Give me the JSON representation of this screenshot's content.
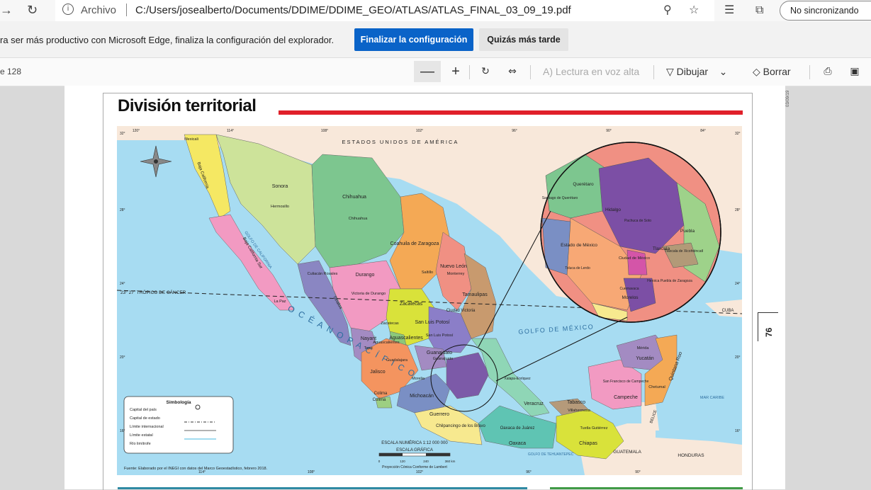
{
  "browser": {
    "scheme_label": "Archivo",
    "url": "C:/Users/josealberto/Documents/DDIME/DDIME_GEO/ATLAS/ATLAS_FINAL_03_09_19.pdf",
    "profile_label": "No sincronizando",
    "icons": [
      "back-arrow-icon",
      "refresh-icon",
      "info-icon",
      "zoom-icon",
      "favorite-star-icon",
      "reading-list-icon",
      "collections-icon"
    ]
  },
  "infobar": {
    "message": "ra ser más productivo con Microsoft Edge, finaliza la configuración del explorador.",
    "primary_button": "Finalizar la configuración",
    "secondary_button": "Quizás más tarde"
  },
  "pdf_toolbar": {
    "page_count": "e 128",
    "read_aloud": "Lectura en voz alta",
    "draw": "Dibujar",
    "erase": "Borrar"
  },
  "map": {
    "title": "División territorial",
    "page_number": "76",
    "side_date": "03/09/19",
    "country_label": "ESTADOS UNIDOS DE AMÉRICA",
    "gulf_label": "GOLFO DE MÉXICO",
    "ocean_label": "O C É A N O   P A C Í F I C O",
    "gulf_california": "GOLFO DE CALIFORNIA",
    "tropic": "23° 27´ TRÓPICO DE CÁNCER",
    "cuba": "CUBA",
    "mar_caribe": "MAR CARIBE",
    "belice": "BELICE",
    "guatemala": "GUATEMALA",
    "honduras": "HONDURAS",
    "golfo_tehuantepec": "GOLFO DE TEHUANTEPEC",
    "top_longitudes": [
      "120°",
      "114°",
      "108°",
      "102°",
      "96°",
      "90°",
      "84°"
    ],
    "bottom_longitudes": [
      "114°",
      "108°",
      "102°",
      "96°",
      "90°"
    ],
    "left_latitudes": [
      "32°",
      "28°",
      "24°",
      "20°",
      "16°"
    ],
    "right_latitudes": [
      "32°",
      "28°",
      "24°",
      "20°",
      "16°"
    ],
    "scale_title": "ESCALA NUMÉRICA 1:12 000 000",
    "scale_graphic": "ESCALA GRÁFICA",
    "scale_ticks": [
      "0",
      "120",
      "240",
      "360 km"
    ],
    "projection": "Proyección Cónica Conforme de Lambert",
    "source": "Fuente: Elaborado por el INEGI con datos del Marco Geoestadístico, febrero 2018.",
    "states": [
      {
        "name": "Mexicali"
      },
      {
        "name": "Baja California"
      },
      {
        "name": "Sonora"
      },
      {
        "name": "Hermosillo"
      },
      {
        "name": "Chihuahua"
      },
      {
        "name": "Chihuahua"
      },
      {
        "name": "Coahuila de Zaragoza"
      },
      {
        "name": "Saltillo"
      },
      {
        "name": "Nuevo León"
      },
      {
        "name": "Monterrey"
      },
      {
        "name": "Tamaulipas"
      },
      {
        "name": "Ciudad Victoria"
      },
      {
        "name": "Durango"
      },
      {
        "name": "Victoria de Durango"
      },
      {
        "name": "Sinaloa"
      },
      {
        "name": "Culiacán Rosales"
      },
      {
        "name": "Baja California Sur"
      },
      {
        "name": "La Paz"
      },
      {
        "name": "Zacatecas"
      },
      {
        "name": "Zacatecas"
      },
      {
        "name": "San Luis Potosí"
      },
      {
        "name": "San Luis Potosí"
      },
      {
        "name": "Aguascalientes"
      },
      {
        "name": "Aguascalientes"
      },
      {
        "name": "Nayarit"
      },
      {
        "name": "Tepic"
      },
      {
        "name": "Guanajuato"
      },
      {
        "name": "Guanajuato"
      },
      {
        "name": "Jalisco"
      },
      {
        "name": "Guadalajara"
      },
      {
        "name": "Colima"
      },
      {
        "name": "Colima"
      },
      {
        "name": "Michoacán"
      },
      {
        "name": "Morelia"
      },
      {
        "name": "Guerrero"
      },
      {
        "name": "Chilpancingo de los Bravo"
      },
      {
        "name": "Oaxaca"
      },
      {
        "name": "Oaxaca de Juárez"
      },
      {
        "name": "Veracruz"
      },
      {
        "name": "Xalapa-Enríquez"
      },
      {
        "name": "Tabasco"
      },
      {
        "name": "Villahermosa"
      },
      {
        "name": "Chiapas"
      },
      {
        "name": "Tuxtla Gutiérrez"
      },
      {
        "name": "Campeche"
      },
      {
        "name": "San Francisco de Campeche"
      },
      {
        "name": "Yucatán"
      },
      {
        "name": "Mérida"
      },
      {
        "name": "Quintana Roo"
      },
      {
        "name": "Chetumal"
      }
    ],
    "inset": [
      {
        "name": "Querétaro"
      },
      {
        "name": "Santiago de Querétaro"
      },
      {
        "name": "Hidalgo"
      },
      {
        "name": "Pachuca de Soto"
      },
      {
        "name": "Puebla"
      },
      {
        "name": "Tlaxcala"
      },
      {
        "name": "Tlaxcala de Xicohténcatl"
      },
      {
        "name": "Estado de México"
      },
      {
        "name": "Toluca de Lerdo"
      },
      {
        "name": "Ciudad de México"
      },
      {
        "name": "Cuernavaca"
      },
      {
        "name": "Morelos"
      },
      {
        "name": "Heroica Puebla de Zaragoza"
      }
    ],
    "legend": {
      "title": "Simbología",
      "items": [
        "Capital del país",
        "Capital de estado",
        "Límite internacional",
        "Límite estatal",
        "Río limítrofe"
      ]
    },
    "colors": {
      "ocean": "#9fd9f2",
      "usa": "#f7e6d6",
      "red_bar": "#e0202a"
    }
  }
}
